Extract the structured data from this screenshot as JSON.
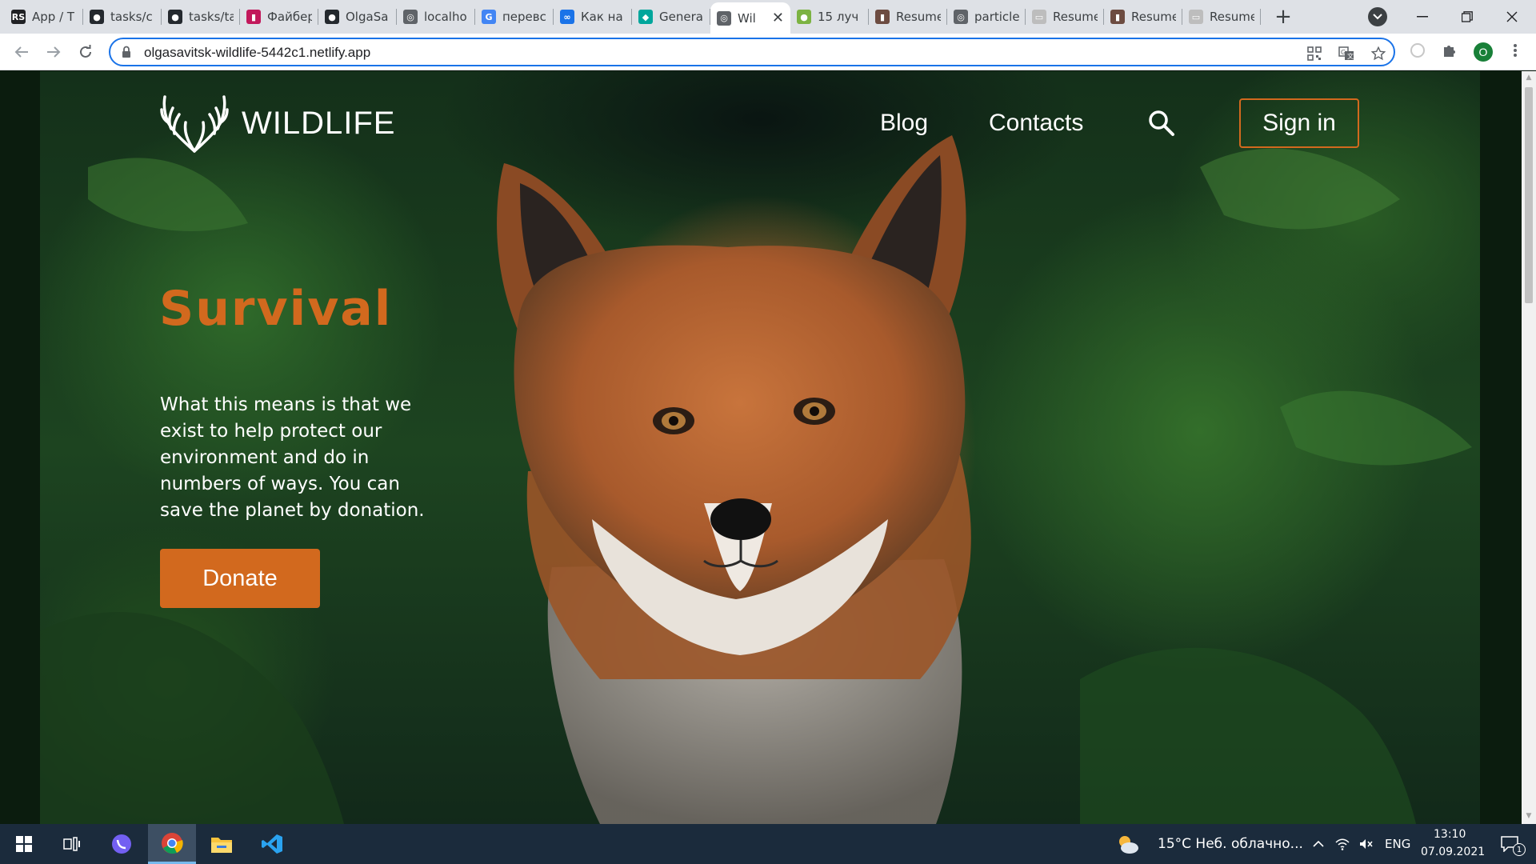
{
  "browser": {
    "tabs": [
      {
        "label": "App / T",
        "icon": "rs-icon"
      },
      {
        "label": "tasks/c",
        "icon": "github-icon"
      },
      {
        "label": "tasks/ta",
        "icon": "github-icon"
      },
      {
        "label": "Файбер",
        "icon": "figma-icon"
      },
      {
        "label": "OlgaSa",
        "icon": "github-icon"
      },
      {
        "label": "localho",
        "icon": "globe-icon"
      },
      {
        "label": "перевс",
        "icon": "google-icon"
      },
      {
        "label": "Как на",
        "icon": "nodes-icon"
      },
      {
        "label": "Genera",
        "icon": "diamond-icon"
      },
      {
        "label": "Wil",
        "icon": "globe-icon",
        "active": true
      },
      {
        "label": "15 луч",
        "icon": "leaf-icon"
      },
      {
        "label": "Resume",
        "icon": "resume-icon"
      },
      {
        "label": "particle",
        "icon": "globe-icon"
      },
      {
        "label": "Resume",
        "icon": "doc-icon"
      },
      {
        "label": "Resume",
        "icon": "resume-icon"
      },
      {
        "label": "Resume",
        "icon": "doc-icon"
      }
    ],
    "url": "olgasavitsk-wildlife-5442c1.netlify.app",
    "profile_initial": "O"
  },
  "site": {
    "logo_text": "WILDLIFE",
    "nav": {
      "blog": "Blog",
      "contacts": "Contacts",
      "signin": "Sign in"
    },
    "hero": {
      "title": "Survival",
      "text": "What this means is that we exist to help protect our environment and do in numbers of ways. You can save the planet by donation.",
      "donate": "Donate"
    },
    "colors": {
      "accent": "#d2691e",
      "text": "#ffffff"
    }
  },
  "taskbar": {
    "weather": "15°C  Неб. облачно...",
    "lang": "ENG",
    "time": "13:10",
    "date": "07.09.2021",
    "notifications": "1"
  }
}
